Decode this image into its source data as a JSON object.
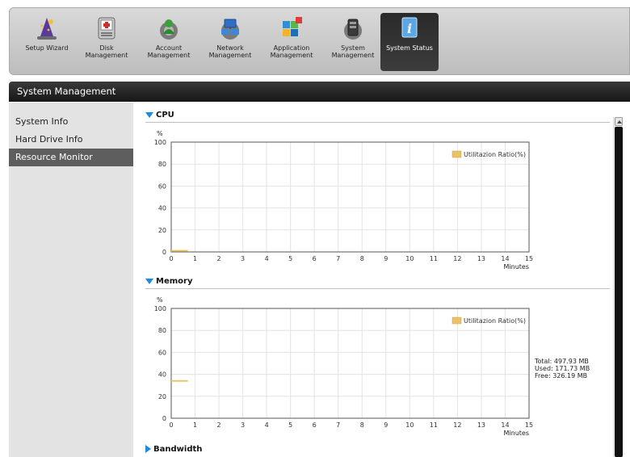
{
  "toolbar": {
    "items": [
      {
        "label": "Setup Wizard",
        "icon": "wizard-icon"
      },
      {
        "label": "Disk Management",
        "icon": "disk-icon"
      },
      {
        "label": "Account Management",
        "icon": "account-icon"
      },
      {
        "label": "Network Management",
        "icon": "network-icon"
      },
      {
        "label": "Application Management",
        "icon": "application-icon"
      },
      {
        "label": "System Management",
        "icon": "system-icon"
      },
      {
        "label": "System Status",
        "icon": "info-icon",
        "active": true
      }
    ]
  },
  "section_header": "System Management",
  "sidebar": {
    "items": [
      {
        "label": "System Info"
      },
      {
        "label": "Hard Drive Info"
      },
      {
        "label": "Resource Monitor",
        "selected": true
      }
    ]
  },
  "cpu": {
    "title": "CPU",
    "unit": "%",
    "xunit": "Minutes",
    "legend": "Utilitazion Ratio(%)"
  },
  "memory": {
    "title": "Memory",
    "unit": "%",
    "xunit": "Minutes",
    "legend": "Utilitazion Ratio(%)",
    "total": "Total: 497.93 MB",
    "used": "Used: 171.73 MB",
    "free": "Free: 326.19 MB"
  },
  "bandwidth": {
    "title": "Bandwidth"
  },
  "colors": {
    "accent": "#1a8be0",
    "series": "#e8c36a",
    "header_bg": "#1c1c1c",
    "selected_bg": "#5e5e5e"
  },
  "chart_data": [
    {
      "type": "line",
      "name_ref": "cpu",
      "x": [
        0,
        0.7
      ],
      "y": [
        1,
        1
      ],
      "xlim": [
        0,
        15
      ],
      "ylim": [
        0,
        100
      ],
      "xticks": [
        0,
        1,
        2,
        3,
        4,
        5,
        6,
        7,
        8,
        9,
        10,
        11,
        12,
        13,
        14,
        15
      ],
      "yticks": [
        0,
        20,
        40,
        60,
        80,
        100
      ],
      "xlabel": "Minutes",
      "ylabel": "%",
      "legend": "Utilitazion Ratio(%)",
      "legend_position": "top-right",
      "grid": true
    },
    {
      "type": "line",
      "name_ref": "memory",
      "x": [
        0,
        0.7
      ],
      "y": [
        34,
        34
      ],
      "xlim": [
        0,
        15
      ],
      "ylim": [
        0,
        100
      ],
      "xticks": [
        0,
        1,
        2,
        3,
        4,
        5,
        6,
        7,
        8,
        9,
        10,
        11,
        12,
        13,
        14,
        15
      ],
      "yticks": [
        0,
        20,
        40,
        60,
        80,
        100
      ],
      "xlabel": "Minutes",
      "ylabel": "%",
      "legend": "Utilitazion Ratio(%)",
      "legend_position": "top-right",
      "grid": true
    }
  ]
}
